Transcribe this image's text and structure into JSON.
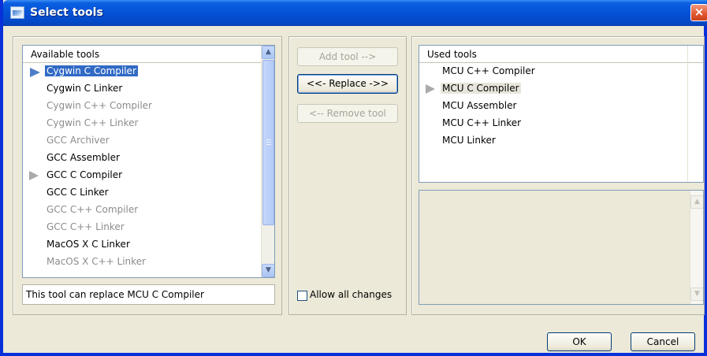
{
  "window": {
    "title": "Select tools",
    "close_label": "×"
  },
  "available": {
    "header": "Available tools",
    "items": [
      {
        "label": "Cygwin C Compiler",
        "state": "selected",
        "marker": "blue-arrow"
      },
      {
        "label": "Cygwin C Linker",
        "state": "normal"
      },
      {
        "label": "Cygwin C++ Compiler",
        "state": "disabled"
      },
      {
        "label": "Cygwin C++ Linker",
        "state": "disabled"
      },
      {
        "label": "GCC Archiver",
        "state": "disabled"
      },
      {
        "label": "GCC Assembler",
        "state": "normal"
      },
      {
        "label": "GCC C Compiler",
        "state": "normal",
        "marker": "grey-arrow"
      },
      {
        "label": "GCC C Linker",
        "state": "normal"
      },
      {
        "label": "GCC C++ Compiler",
        "state": "disabled"
      },
      {
        "label": "GCC C++ Linker",
        "state": "disabled"
      },
      {
        "label": "MacOS X C Linker",
        "state": "normal"
      },
      {
        "label": "MacOS X C++ Linker",
        "state": "disabled"
      }
    ],
    "status": "This tool can replace MCU C Compiler"
  },
  "actions": {
    "add": "Add tool -->",
    "replace": "<<- Replace ->>",
    "remove": "<-- Remove tool",
    "allow_all_label": "Allow all changes",
    "allow_all_checked": false
  },
  "used": {
    "header": "Used tools",
    "items": [
      {
        "label": "MCU C++ Compiler",
        "state": "normal"
      },
      {
        "label": "MCU C Compiler",
        "state": "highlight",
        "marker": "grey-arrow"
      },
      {
        "label": "MCU Assembler",
        "state": "normal"
      },
      {
        "label": "MCU C++ Linker",
        "state": "normal"
      },
      {
        "label": "MCU Linker",
        "state": "normal"
      }
    ]
  },
  "footer": {
    "ok": "OK",
    "cancel": "Cancel"
  },
  "icons": {
    "scroll_up": "▲",
    "scroll_down": "▼"
  },
  "colors": {
    "titlebar": "#0450d4",
    "selection": "#316ac5",
    "disabled_text": "#8c8c8c"
  }
}
